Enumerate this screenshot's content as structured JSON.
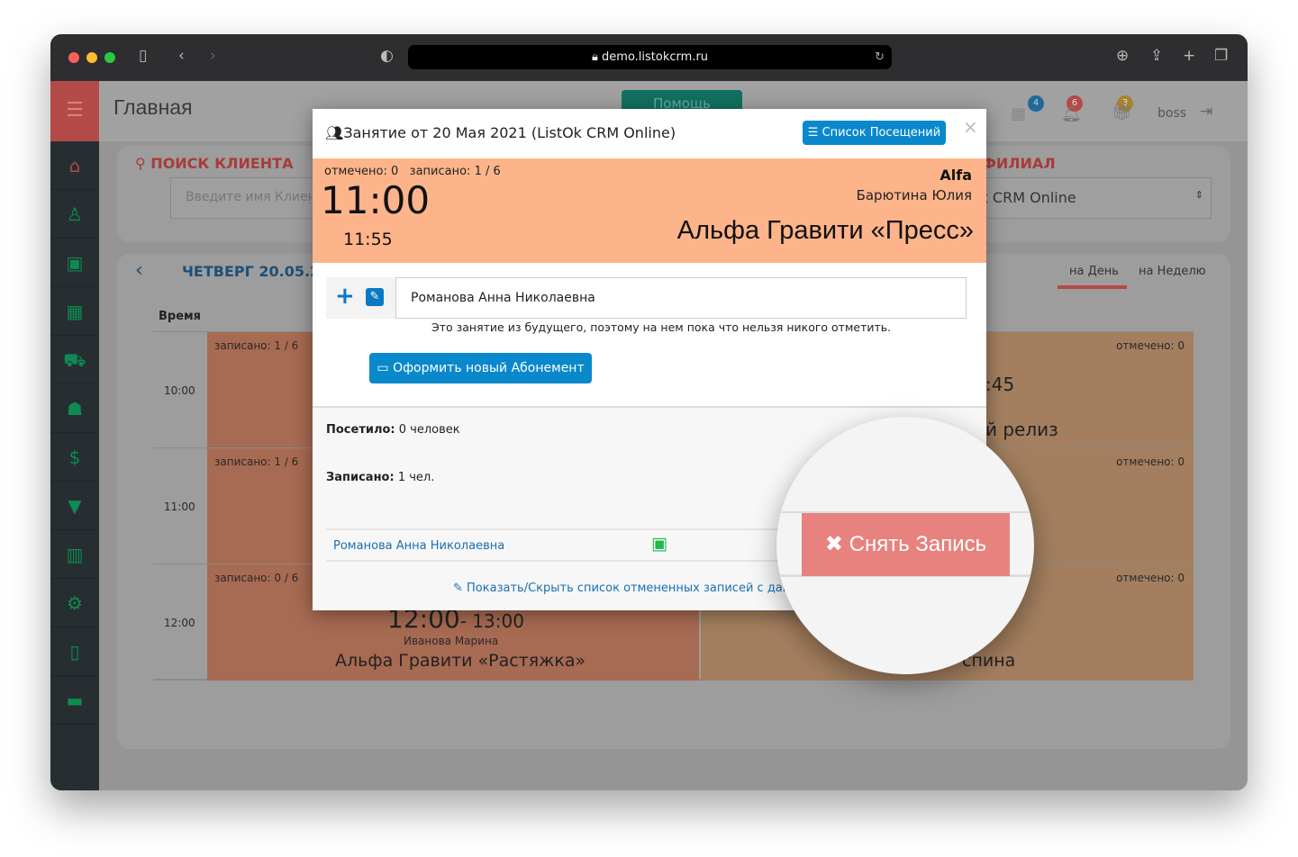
{
  "browser": {
    "url": "demo.listokcrm.ru"
  },
  "header": {
    "title": "Главная",
    "help_label": "Помощь",
    "badges": {
      "messages": "4",
      "calendar": "6",
      "notifications": "3"
    },
    "user": "boss"
  },
  "colors": {
    "accent_red": "#b34a47",
    "sidebar": "#262e31",
    "brand_green": "#0e8b52",
    "primary_blue": "#0a88cc",
    "lesson_orange": "#fdb48a",
    "remove_pink": "#e8827f"
  },
  "search": {
    "title": "ПОИСК КЛИЕНТА",
    "placeholder": "Введите имя Клиента"
  },
  "branch": {
    "title": "ФИЛИАЛ",
    "selected": "ListOk CRM Online"
  },
  "schedule": {
    "day_title": "ЧЕТВЕРГ 20.05.2021",
    "tabs": [
      "на День",
      "на Неделю"
    ],
    "active_tab": "на День",
    "time_header": "Время",
    "rows": [
      {
        "time": "10:00",
        "left": {
          "enrolled": "записано: 1 / 6"
        },
        "right": {
          "marked": "отмечено: 0",
          "partial_time": ":45",
          "partial_title": "й релиз"
        }
      },
      {
        "time": "11:00",
        "left": {
          "enrolled": "записано: 1 / 6"
        },
        "right": {
          "marked": "отмечено: 0"
        }
      },
      {
        "time": "12:00",
        "left": {
          "enrolled": "записано: 0 / 6",
          "time_start": "12:00",
          "time_end": "- 13:00",
          "trainer": "Иванова Марина",
          "title": "Альфа Гравити «Растяжка»"
        },
        "right": {
          "marked": "отмечено: 0",
          "partial_title": "спина"
        }
      }
    ]
  },
  "modal": {
    "title": "Занятие от 20 Мая 2021 (ListOk CRM Online)",
    "visits_list_label": "Список Посещений",
    "close": "×",
    "marked": "отмечено: 0",
    "enrolled": "записано: 1 / 6",
    "start": "11:00",
    "end": "11:55",
    "group": "Alfa",
    "trainer": "Барютина Юлия",
    "lesson": "Альфа Гравити «Пресс»",
    "client_input": "Романова Анна Николаевна",
    "notice": "Это занятие из будущего, поэтому на нем пока что нельзя никого отметить.",
    "new_subscription_label": "Оформить новый Абонемент",
    "visited_label": "Посетило:",
    "visited_value": "0 человек",
    "enrolled_label": "Записано:",
    "enrolled_value": "1 чел.",
    "attendee": "Романова Анна Николаевна",
    "toggle_cancelled": "Показать/Скрыть список отмененных записей с данно"
  },
  "magnifier": {
    "remove_label": "Снять Запись"
  }
}
